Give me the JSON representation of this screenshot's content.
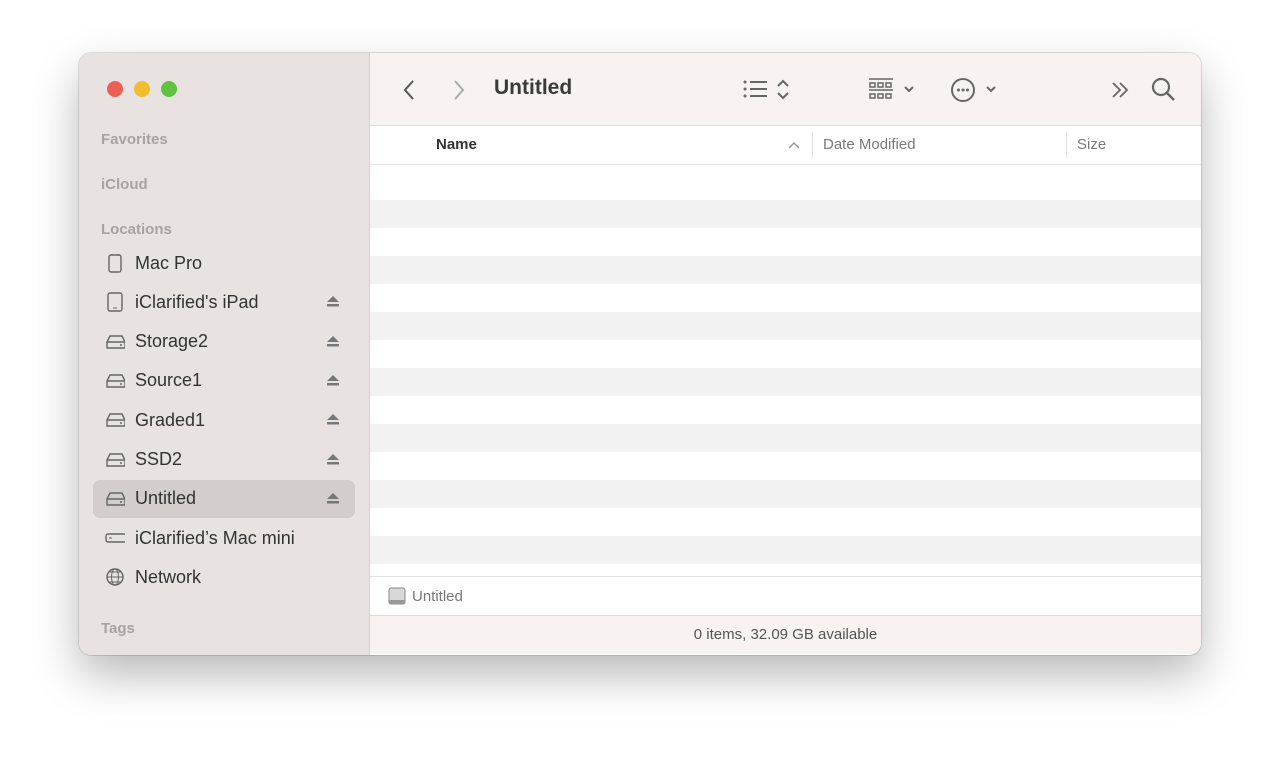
{
  "window": {
    "title": "Untitled"
  },
  "sidebar": {
    "sections": {
      "favorites": "Favorites",
      "icloud": "iCloud",
      "locations": "Locations",
      "tags": "Tags"
    },
    "items": [
      {
        "label": "Mac Pro",
        "icon": "mac-pro-icon",
        "eject": false
      },
      {
        "label": "iClarified's iPad",
        "icon": "ipad-icon",
        "eject": true
      },
      {
        "label": "Storage2",
        "icon": "drive-icon",
        "eject": true
      },
      {
        "label": "Source1",
        "icon": "drive-icon",
        "eject": true
      },
      {
        "label": "Graded1",
        "icon": "drive-icon",
        "eject": true
      },
      {
        "label": "SSD2",
        "icon": "drive-icon",
        "eject": true
      },
      {
        "label": "Untitled",
        "icon": "drive-icon",
        "eject": true,
        "selected": true
      },
      {
        "label": "iClarified’s Mac mini",
        "icon": "mac-mini-icon",
        "eject": false
      },
      {
        "label": "Network",
        "icon": "network-icon",
        "eject": false
      }
    ]
  },
  "columns": {
    "name": "Name",
    "date": "Date Modified",
    "size": "Size"
  },
  "path_bar": {
    "label": "Untitled"
  },
  "status": "0 items, 32.09 GB available"
}
